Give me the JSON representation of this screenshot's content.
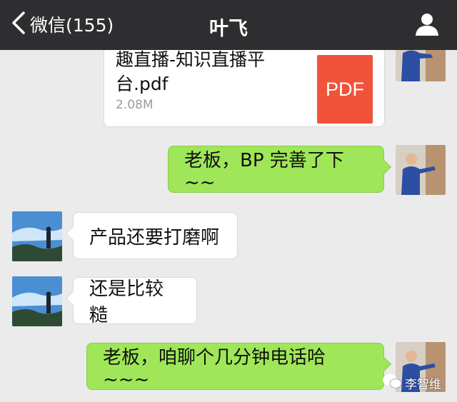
{
  "navbar": {
    "back_label": "微信(155)",
    "title": "叶飞"
  },
  "messages": [
    {
      "sender": "self",
      "type": "file",
      "file_name": "趣直播-知识直播平台.pdf",
      "file_name_visible": "趣直播-知识直播平\n台.pdf",
      "file_size": "2.08M",
      "file_icon_label": "PDF"
    },
    {
      "sender": "self",
      "type": "text",
      "text": "老板，BP 完善了下~~"
    },
    {
      "sender": "other",
      "type": "text",
      "text": "产品还要打磨啊"
    },
    {
      "sender": "other",
      "type": "text",
      "text": "还是比较糙"
    },
    {
      "sender": "self",
      "type": "text",
      "text": "老板，咱聊个几分钟电话哈~~~"
    }
  ],
  "watermark": {
    "text": "李智维"
  },
  "colors": {
    "navbar_bg": "#2e2e31",
    "chat_bg": "#ebebeb",
    "self_bubble": "#9fe658",
    "other_bubble": "#ffffff",
    "pdf_icon": "#f0533a"
  },
  "icons": {
    "back": "chevron-left-icon",
    "profile": "person-icon",
    "file": "pdf-icon",
    "watermark": "wechat-icon"
  }
}
